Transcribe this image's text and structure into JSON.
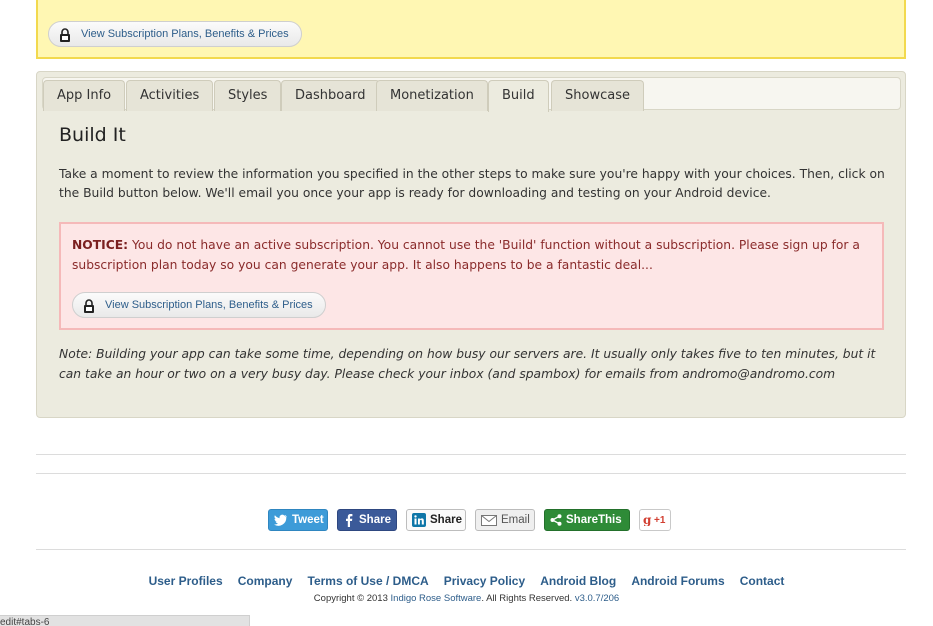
{
  "top_notice": {
    "plans_button": "View Subscription Plans, Benefits & Prices"
  },
  "tabs": [
    {
      "label": "App Info"
    },
    {
      "label": "Activities"
    },
    {
      "label": "Styles"
    },
    {
      "label": "Dashboard"
    },
    {
      "label": "Monetization"
    },
    {
      "label": "Build",
      "active": true
    },
    {
      "label": "Showcase"
    }
  ],
  "build": {
    "title": "Build It",
    "intro": "Take a moment to review the information you specified in the other steps to make sure you're happy with your choices. Then, click on the Build button below. We'll email you once your app is ready for downloading and testing on your Android device.",
    "notice_label": "NOTICE:",
    "notice_text": "You do not have an active subscription. You cannot use the 'Build' function without a subscription. Please sign up for a subscription plan today so you can generate your app. It also happens to be a fantastic deal...",
    "plans_button": "View Subscription Plans, Benefits & Prices",
    "note": "Note: Building your app can take some time, depending on how busy our servers are. It usually only takes five to ten minutes, but it can take an hour or two on a very busy day. Please check your inbox (and spambox) for emails from andromo@andromo.com"
  },
  "share": {
    "tweet": "Tweet",
    "facebook": "Share",
    "linkedin": "Share",
    "email": "Email",
    "sharethis": "ShareThis",
    "gplus": "+1"
  },
  "footer": {
    "links": [
      "User Profiles",
      "Company",
      "Terms of Use / DMCA",
      "Privacy Policy",
      "Android Blog",
      "Android Forums",
      "Contact"
    ],
    "copyright_prefix": "Copyright © 2013",
    "copyright_company": "Indigo Rose Software",
    "copyright_suffix": ". All Rights Reserved.",
    "version": "v3.0.7/206"
  },
  "status_bar": "edit#tabs-6",
  "colors": {
    "notice_bg": "#fff7b3",
    "error_bg": "#fde6e6",
    "link": "#2d5d8a",
    "panel_bg": "#ecebdf"
  }
}
